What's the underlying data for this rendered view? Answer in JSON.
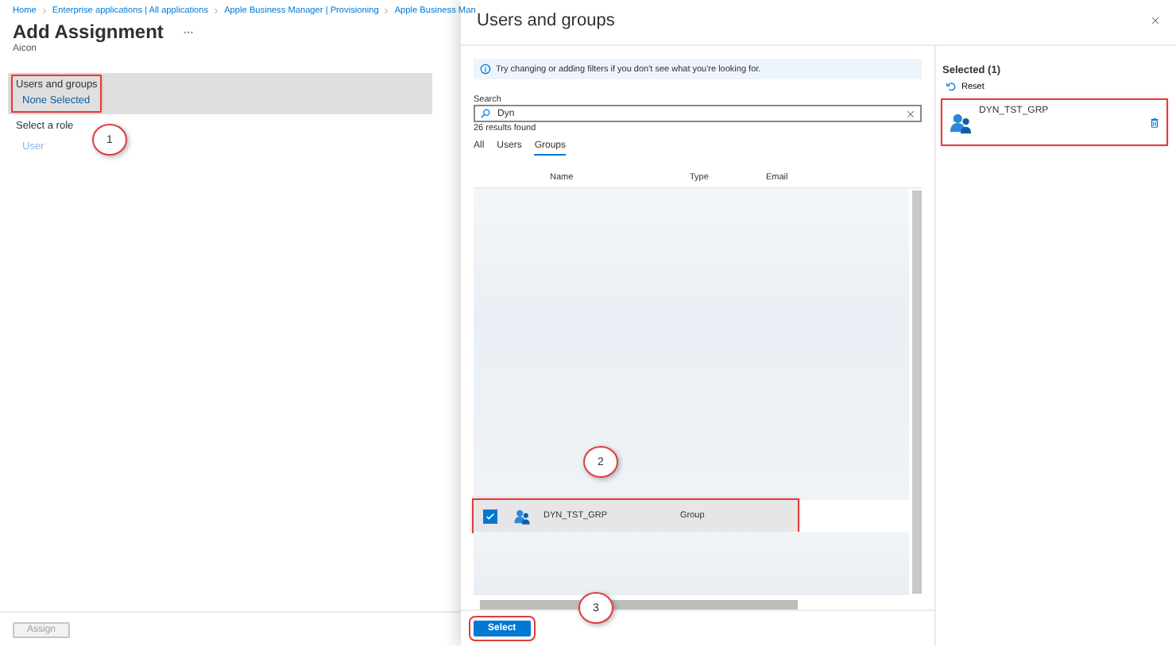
{
  "breadcrumb": [
    "Home",
    "Enterprise applications | All applications",
    "Apple Business Manager | Provisioning",
    "Apple Business Man"
  ],
  "page": {
    "title": "Add Assignment",
    "subtitle": "Aicon"
  },
  "fields": [
    {
      "label": "Users and groups",
      "value": "None Selected",
      "highlighted": true
    },
    {
      "label": "Select a role",
      "value": "User",
      "highlighted": false
    }
  ],
  "footer": {
    "button": "Assign",
    "disabled": true
  },
  "panel": {
    "title": "Users and groups",
    "info": "Try changing or adding filters if you don't see what you're looking for.",
    "search_label": "Search",
    "search_value": "Dyn",
    "results": "26 results found",
    "tabs": [
      {
        "label": "All",
        "selected": false
      },
      {
        "label": "Users",
        "selected": false
      },
      {
        "label": "Groups",
        "selected": true
      }
    ],
    "columns": [
      "Name",
      "Type",
      "Email"
    ],
    "rows": [
      {
        "name": "DYN_TST_GRP",
        "type": "Group",
        "checked": true,
        "highlighted": true
      }
    ],
    "select_button": {
      "label": "Select",
      "highlighted": true
    },
    "selected_title": "Selected (1)",
    "reset": "Reset",
    "selected_items": [
      {
        "name": "DYN_TST_GRP",
        "highlighted": true
      }
    ]
  },
  "callouts": [
    "1",
    "2",
    "3"
  ]
}
